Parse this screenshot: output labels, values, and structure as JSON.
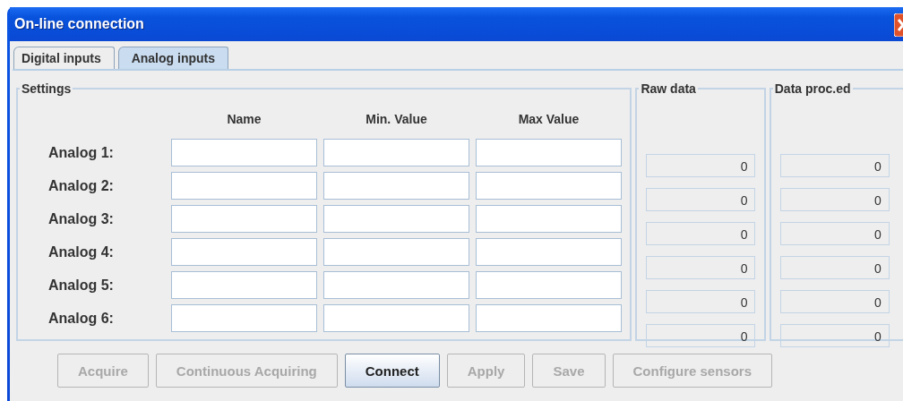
{
  "window": {
    "title": "On-line connection"
  },
  "tabs": [
    {
      "label": "Digital inputs",
      "selected": false
    },
    {
      "label": "Analog inputs",
      "selected": true
    }
  ],
  "settings": {
    "title": "Settings",
    "columns": [
      "Name",
      "Min. Value",
      "Max Value"
    ],
    "rows": [
      {
        "label": "Analog 1:"
      },
      {
        "label": "Analog 2:"
      },
      {
        "label": "Analog 3:"
      },
      {
        "label": "Analog 4:"
      },
      {
        "label": "Analog 5:"
      },
      {
        "label": "Analog 6:"
      }
    ]
  },
  "raw_data": {
    "title": "Raw data",
    "values": [
      "0",
      "0",
      "0",
      "0",
      "0",
      "0"
    ]
  },
  "data_processed": {
    "title": "Data proc.ed",
    "values": [
      "0",
      "0",
      "0",
      "0",
      "0",
      "0"
    ]
  },
  "buttons": [
    {
      "label": "Acquire",
      "disabled": true
    },
    {
      "label": "Continuous Acquiring",
      "disabled": true
    },
    {
      "label": "Connect",
      "disabled": false
    },
    {
      "label": "Apply",
      "disabled": true
    },
    {
      "label": "Save",
      "disabled": true
    },
    {
      "label": "Configure sensors",
      "disabled": true
    }
  ]
}
